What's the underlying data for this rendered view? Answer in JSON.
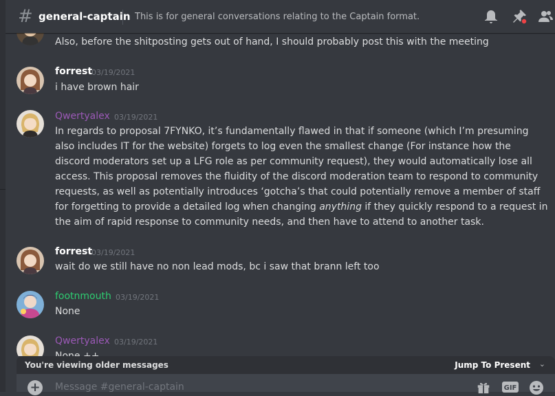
{
  "header": {
    "channel_name": "general-captain",
    "topic": "This is for general conversations relating to the Captain format."
  },
  "messages": [
    {
      "id": "m0",
      "continuation": "Also, before the shitposting gets out of hand, I should probably post this with the meeting"
    },
    {
      "id": "m1",
      "username": "forrest",
      "username_color": "#ffffff",
      "timestamp": "03/19/2021",
      "lines": [
        "i have brown hair"
      ]
    },
    {
      "id": "m2",
      "username": "Qwertyalex",
      "username_color": "#9b59b6",
      "timestamp": "03/19/2021",
      "lines": [
        "In regards to proposal 7FYNKO, it’s fundamentally flawed in that if someone (which I’m presuming",
        "also includes IT for the website) forgets to log even the smallest change (For instance how the",
        "discord moderators set up a LFG role as per community request), they would automatically lose all",
        "access. This proposal removes the fluidity of the discord moderation team to respond to community",
        "requests, as well as potentially introduces ‘gotcha’s that could potentially remove a member of staff"
      ],
      "line6_before": "for forgetting to provide a detailed log when changing ",
      "line6_italic": "anything",
      "line6_after": " if they quickly respond to a request in",
      "line7": "the aim of rapid response to community needs, and then have to attend to another task."
    },
    {
      "id": "m3",
      "username": "forrest",
      "username_color": "#ffffff",
      "timestamp": "03/19/2021",
      "lines": [
        "wait do we still have no non lead mods, bc i saw that brann left too"
      ]
    },
    {
      "id": "m4",
      "username": "footnmouth",
      "username_color": "#2ecc71",
      "timestamp": "03/19/2021",
      "lines": [
        "None"
      ]
    },
    {
      "id": "m5",
      "username": "Qwertyalex",
      "username_color": "#9b59b6",
      "timestamp": "03/19/2021",
      "lines": [
        "None ++"
      ]
    }
  ],
  "older_bar": {
    "text": "You're viewing older messages",
    "jump_label": "Jump To Present",
    "jump_icon": "chevron-down-icon"
  },
  "composer": {
    "placeholder": "Message #general-captain",
    "gif_label": "GIF"
  },
  "icons": {
    "bell": "bell-icon",
    "pin": "pin-icon",
    "members": "members-icon",
    "gift": "gift-icon",
    "emoji": "emoji-icon"
  },
  "colors": {
    "background": "#36393f",
    "qwertyalex": "#9b59b6",
    "footnmouth": "#2ecc71",
    "pin_badge": "#ed4245"
  }
}
